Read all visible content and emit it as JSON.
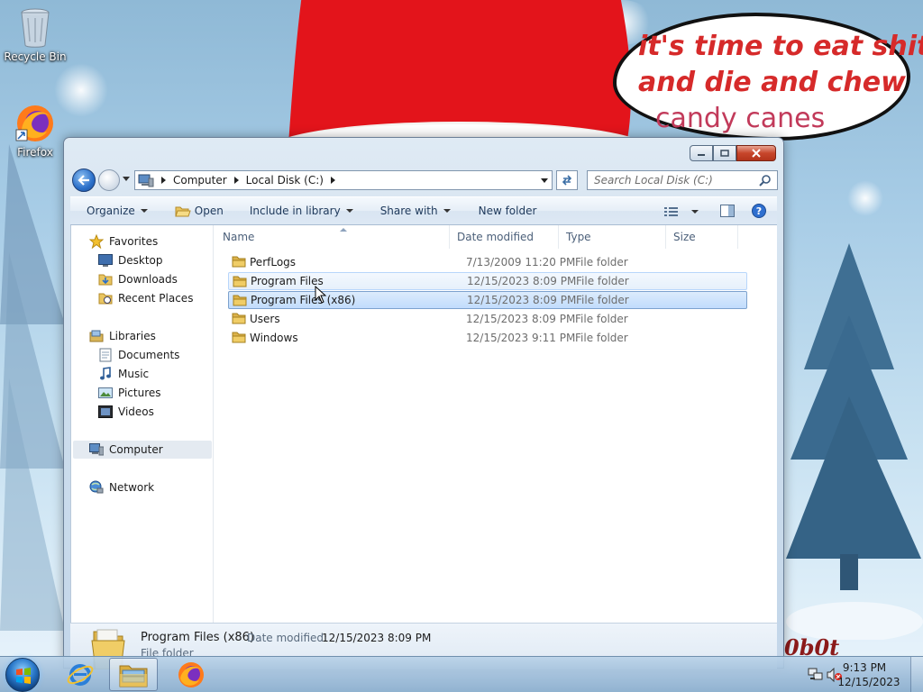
{
  "desktop": {
    "icons": [
      {
        "label": "Recycle Bin",
        "icon": "recycle-bin-icon"
      },
      {
        "label": "Firefox",
        "icon": "firefox-icon"
      }
    ],
    "wallpaper": {
      "speech_line1": "it's time to eat shit",
      "speech_line2": "and die and chew",
      "speech_line3": "candy canes",
      "signature": "0b0t"
    }
  },
  "window": {
    "breadcrumb": [
      "Computer",
      "Local Disk (C:)"
    ],
    "search_placeholder": "Search Local Disk (C:)",
    "toolbar": {
      "organize": "Organize",
      "open": "Open",
      "include_in_library": "Include in library",
      "share_with": "Share with",
      "new_folder": "New folder"
    },
    "nav": {
      "favorites": "Favorites",
      "desktop": "Desktop",
      "downloads": "Downloads",
      "recent_places": "Recent Places",
      "libraries": "Libraries",
      "documents": "Documents",
      "music": "Music",
      "pictures": "Pictures",
      "videos": "Videos",
      "computer": "Computer",
      "network": "Network"
    },
    "columns": {
      "name": "Name",
      "date_modified": "Date modified",
      "type": "Type",
      "size": "Size"
    },
    "files": [
      {
        "name": "PerfLogs",
        "date": "7/13/2009 11:20 PM",
        "type": "File folder",
        "state": "normal"
      },
      {
        "name": "Program Files",
        "date": "12/15/2023 8:09 PM",
        "type": "File folder",
        "state": "hover"
      },
      {
        "name": "Program Files (x86)",
        "date": "12/15/2023 8:09 PM",
        "type": "File folder",
        "state": "selected"
      },
      {
        "name": "Users",
        "date": "12/15/2023 8:09 PM",
        "type": "File folder",
        "state": "normal"
      },
      {
        "name": "Windows",
        "date": "12/15/2023 9:11 PM",
        "type": "File folder",
        "state": "normal"
      }
    ],
    "details": {
      "name": "Program Files (x86)",
      "modified_label": "Date modified:",
      "modified_value": "12/15/2023 8:09 PM",
      "type": "File folder"
    }
  },
  "taskbar": {
    "time": "9:13 PM",
    "date": "12/15/2023",
    "pinned": [
      "internet-explorer-icon",
      "windows-explorer-icon",
      "firefox-icon"
    ]
  },
  "colors": {
    "selection": "#c1dcfc",
    "selection_border": "#7da2ce",
    "cmd_text": "#1e395b",
    "speech_text": "#d62a2a"
  }
}
